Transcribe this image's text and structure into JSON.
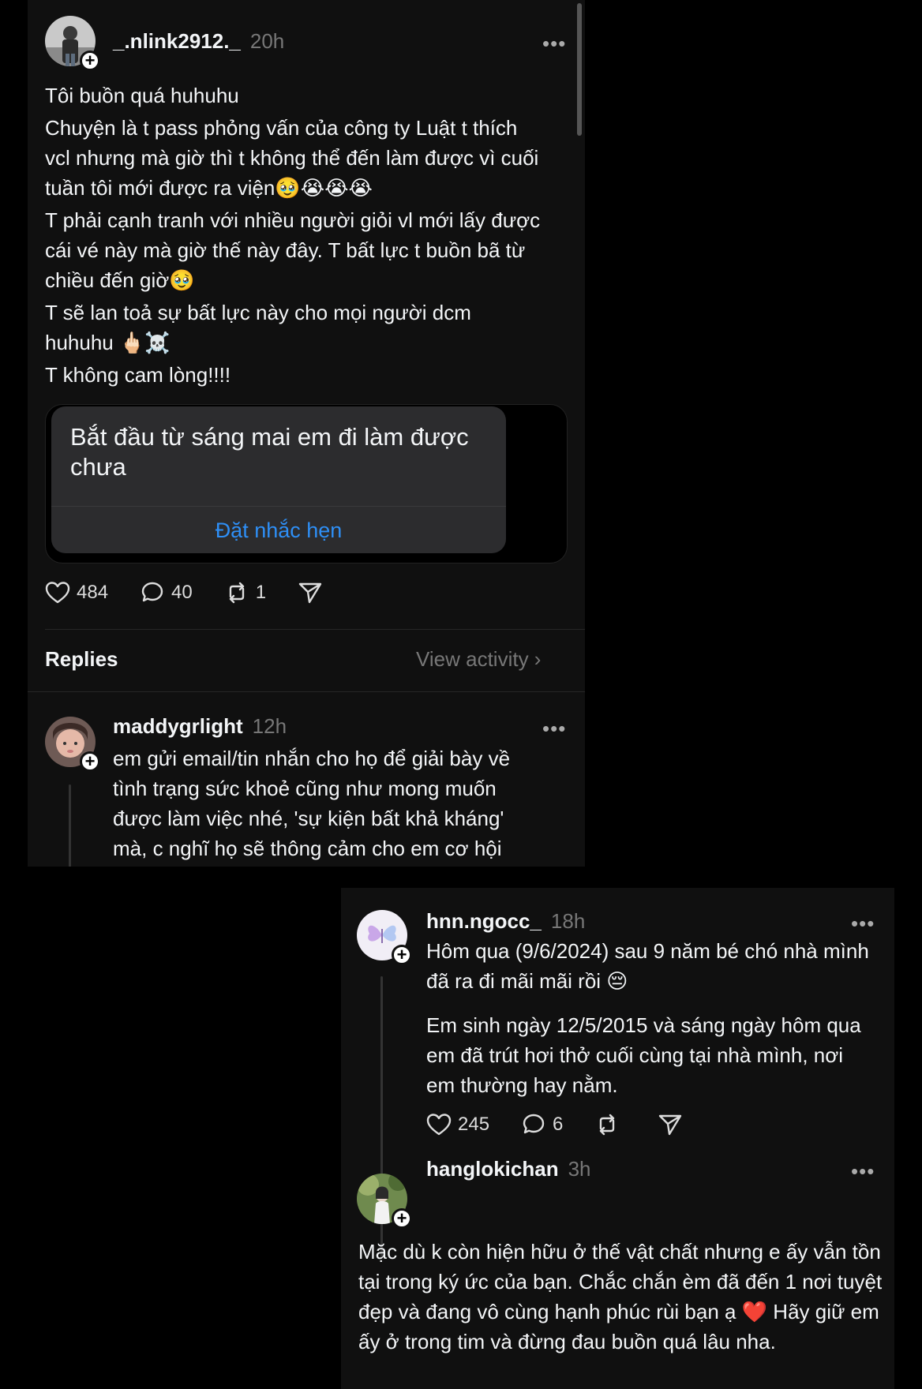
{
  "post": {
    "username": "_.nlink2912._",
    "time": "20h",
    "more": "•••",
    "paragraphs": [
      "Tôi buồn quá huhuhu",
      "Chuyện là t pass phỏng vấn của công ty Luật t thích vcl nhưng mà giờ thì t không thể đến làm được vì cuối tuần tôi mới được ra viện🥹😭😭😭",
      "T phải cạnh tranh với nhiều người giỏi vl mới lấy được cái vé này mà giờ thế này đây. T bất lực t buồn bã từ chiều đến giờ🥹",
      "T sẽ lan toả sự bất lực này cho mọi người dcm huhuhu 🖕🏻☠️",
      "T không cam lòng!!!!"
    ],
    "reminder": {
      "title": "Bắt đầu từ sáng mai em đi làm được chưa",
      "button": "Đặt nhắc hẹn"
    },
    "stats": {
      "likes": "484",
      "comments": "40",
      "reposts": "1"
    },
    "replies_label": "Replies",
    "view_activity": "View activity  ›"
  },
  "reply1": {
    "username": "maddygrlight",
    "time": "12h",
    "more": "•••",
    "text": "em gửi email/tin nhắn cho họ để giải bày về tình trạng sức khoẻ cũng như mong muốn được làm việc nhé, 'sự kiện bất khả kháng' mà, c nghĩ họ sẽ thông cảm cho em cơ hội"
  },
  "post2": {
    "username": "hnn.ngocc_",
    "time": "18h",
    "more": "•••",
    "paragraphs": [
      "Hôm qua (9/6/2024) sau 9 năm bé chó nhà mình đã ra đi mãi mãi rồi 😔",
      "Em sinh ngày 12/5/2015 và sáng ngày hôm qua em đã trút hơi thở cuối cùng tại nhà mình, nơi em thường hay nằm."
    ],
    "stats": {
      "likes": "245",
      "comments": "6"
    }
  },
  "reply2": {
    "username": "hanglokichan",
    "time": "3h",
    "more": "•••",
    "text": "Mặc dù k còn hiện hữu ở thế vật chất nhưng e ấy vẫn tồn tại trong ký ức của bạn. Chắc chắn èm đã đến 1 nơi tuyệt đẹp và đang vô cùng hạnh phúc rùi bạn ạ ❤️ Hãy giữ em ấy ở trong tim và đừng đau buồn quá lâu nha."
  },
  "colors": {
    "background": "#000000",
    "panel": "#101010",
    "link_blue": "#2e8ff6",
    "muted": "#777777"
  },
  "icons": [
    "heart-icon",
    "comment-icon",
    "repost-icon",
    "share-icon",
    "follow-plus-icon",
    "more-icon",
    "chevron-right-icon"
  ]
}
